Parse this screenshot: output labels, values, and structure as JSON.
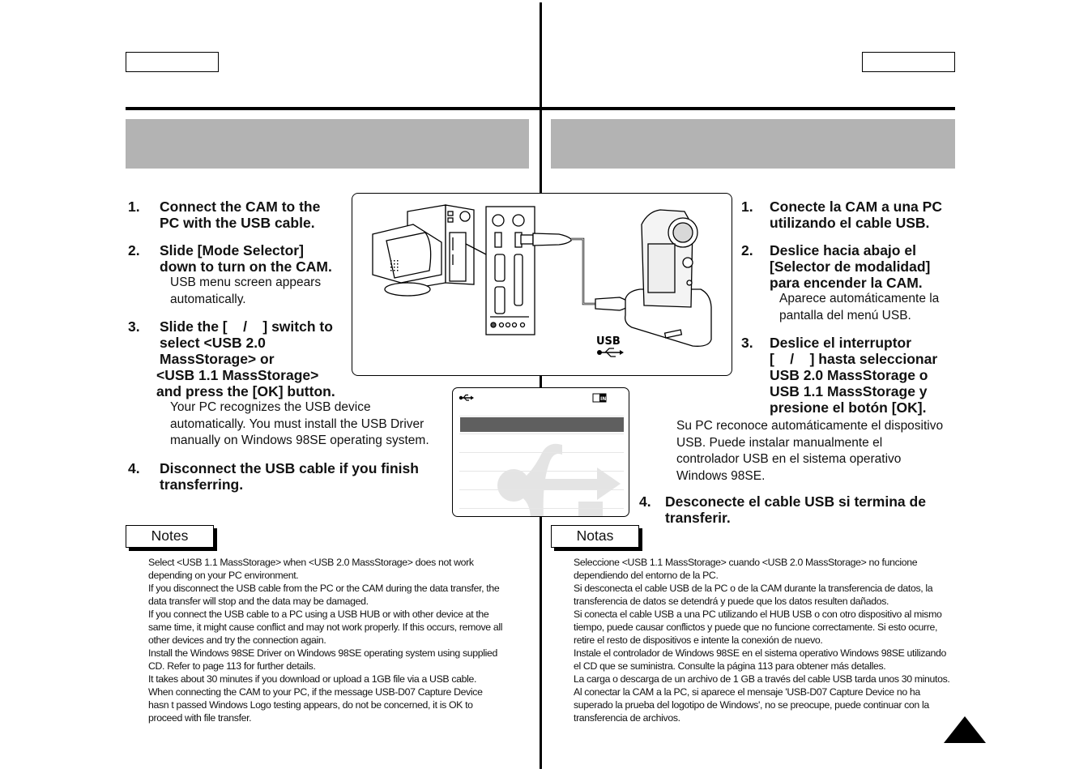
{
  "page": {
    "language_tags": {
      "left": "",
      "right": ""
    },
    "section_titles": {
      "left": "",
      "right": ""
    }
  },
  "english": {
    "steps": [
      {
        "num": "1.",
        "lines": [
          "Connect the CAM to the",
          "PC with the USB cable."
        ]
      },
      {
        "num": "2.",
        "lines": [
          "Slide [Mode Selector]",
          "down to turn on the CAM."
        ],
        "note_lines": [
          "USB menu screen appears",
          "automatically."
        ]
      },
      {
        "num": "3.",
        "lines": [
          "Slide the [    /    ] switch to",
          "select <USB 2.0",
          "MassStorage> or",
          "<USB 1.1 MassStorage>",
          "and press the [OK] button."
        ],
        "note_lines": [
          "Your PC recognizes the USB device",
          "automatically. You must install the USB Driver",
          "manually on Windows 98SE operating system."
        ]
      },
      {
        "num": "4.",
        "lines": [
          "Disconnect the USB cable if you finish",
          "transferring."
        ]
      }
    ],
    "notes_label": "Notes",
    "notes_lines": [
      "Select <USB 1.1 MassStorage> when <USB 2.0 MassStorage> does not work",
      "depending on your PC environment.",
      "If you disconnect the USB cable from the PC or the CAM during the data transfer, the",
      "data transfer will stop and the data may be damaged.",
      "If you connect the USB cable to a PC using a USB HUB or with other device at the",
      "same time, it might cause conflict and may not work properly. If this occurs, remove all",
      "other devices and try the connection again.",
      "Install the Windows 98SE Driver on Windows 98SE operating system using supplied",
      "CD. Refer to page 113 for further details.",
      "It takes about 30 minutes if you download or upload a 1GB file via a USB cable.",
      "When connecting the CAM to your PC, if the message  USB-D07 Capture Device",
      "hasn t passed Windows Logo testing  appears, do not be concerned, it is OK to",
      "proceed with file transfer."
    ]
  },
  "spanish": {
    "steps": [
      {
        "num": "1.",
        "lines": [
          "Conecte la CAM a una PC",
          "utilizando el cable USB."
        ]
      },
      {
        "num": "2.",
        "lines": [
          "Deslice hacia abajo el",
          "[Selector de modalidad]",
          "para encender la CAM."
        ],
        "note_lines": [
          "Aparece automáticamente la",
          "pantalla del menú USB."
        ]
      },
      {
        "num": "3.",
        "lines": [
          "Deslice el interruptor",
          "[    /    ] hasta seleccionar",
          "USB 2.0 MassStorage o",
          "USB 1.1 MassStorage y",
          "presione el botón [OK]."
        ],
        "note_lines": [
          "Su PC reconoce automáticamente el dispositivo",
          "USB. Puede instalar manualmente el",
          "controlador USB en el sistema operativo",
          "Windows 98SE."
        ]
      },
      {
        "num": "4.",
        "lines": [
          "Desconecte el cable USB si termina de",
          "transferir."
        ]
      }
    ],
    "notes_label": "Notas",
    "notes_lines": [
      "Seleccione <USB 1.1 MassStorage> cuando <USB 2.0 MassStorage> no funcione",
      "dependiendo del entorno de la PC.",
      "Si desconecta el cable USB de la PC o de la CAM durante la transferencia de datos, la",
      "transferencia de datos se detendrá y puede que los datos resulten dañados.",
      "Si conecta el cable USB a una PC utilizando el HUB USB o con otro dispositivo al mismo",
      "tiempo, puede causar conflictos y puede que no funcione correctamente. Si esto ocurre,",
      "retire el resto de dispositivos e intente la conexión de nuevo.",
      "Instale el controlador de Windows 98SE en el sistema operativo Windows 98SE utilizando",
      "el CD que se suministra. Consulte la página 113 para obtener más detalles.",
      "La carga o descarga de un archivo de 1 GB a través del cable USB tarda unos 30 minutos.",
      "Al conectar la CAM a la PC, si aparece el mensaje 'USB-D07 Capture Device no ha",
      "superado la prueba del logotipo de Windows', no se preocupe, puede continuar con la",
      "transferencia de archivos."
    ]
  },
  "figure": {
    "usb_label": "USB",
    "icons": [
      "computer-icon",
      "back-panel-icon",
      "usb-cable-icon",
      "camcorder-cradle-icon",
      "usb-trident-icon"
    ]
  },
  "lcd": {
    "icons": [
      "usb-trident-icon",
      "card-in-icon"
    ],
    "card_badge": "IN",
    "colors": {
      "highlight": "#5f5f5f",
      "watermark": "#e4e4e4"
    }
  },
  "colors": {
    "gray_bar": "#b3b3b3",
    "rule": "#000000"
  }
}
